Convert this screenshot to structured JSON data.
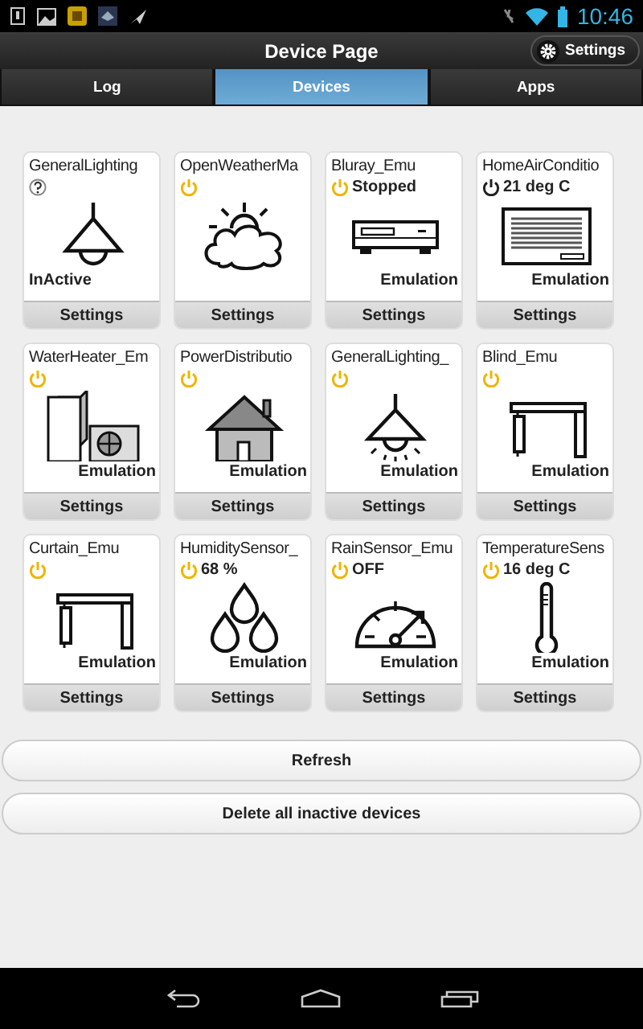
{
  "status_bar": {
    "time": "10:46"
  },
  "header": {
    "title": "Device Page",
    "settings_button": "Settings"
  },
  "tabs": [
    {
      "label": "Log",
      "selected": false
    },
    {
      "label": "Devices",
      "selected": true
    },
    {
      "label": "Apps",
      "selected": false
    }
  ],
  "devices": [
    {
      "name": "GeneralLighting",
      "unknown": true,
      "kind": "lamp",
      "mode": "InActive",
      "settings_button": "Settings"
    },
    {
      "name": "OpenWeatherMa",
      "unknown": false,
      "on": true,
      "kind": "weather",
      "settings_button": "Settings"
    },
    {
      "name": "Bluray_Emu",
      "unknown": false,
      "on": true,
      "status": "Stopped",
      "kind": "player",
      "mode": "Emulation",
      "settings_button": "Settings"
    },
    {
      "name": "HomeAirConditio",
      "unknown": false,
      "on": false,
      "status": "21 deg C",
      "kind": "aircon",
      "mode": "Emulation",
      "settings_button": "Settings"
    },
    {
      "name": "WaterHeater_Em",
      "unknown": false,
      "on": true,
      "kind": "heater",
      "mode": "Emulation",
      "settings_button": "Settings"
    },
    {
      "name": "PowerDistributio",
      "unknown": false,
      "on": true,
      "kind": "house",
      "mode": "Emulation",
      "settings_button": "Settings"
    },
    {
      "name": "GeneralLighting_",
      "unknown": false,
      "on": true,
      "kind": "lamp_lit",
      "mode": "Emulation",
      "settings_button": "Settings"
    },
    {
      "name": "Blind_Emu",
      "unknown": false,
      "on": true,
      "kind": "blind",
      "mode": "Emulation",
      "settings_button": "Settings"
    },
    {
      "name": "Curtain_Emu",
      "unknown": false,
      "on": true,
      "kind": "blind",
      "mode": "Emulation",
      "settings_button": "Settings"
    },
    {
      "name": "HumiditySensor_",
      "unknown": false,
      "on": true,
      "status": "68 %",
      "kind": "drops",
      "mode": "Emulation",
      "settings_button": "Settings"
    },
    {
      "name": "RainSensor_Emu",
      "unknown": false,
      "on": true,
      "status": "OFF",
      "kind": "gauge",
      "mode": "Emulation",
      "settings_button": "Settings"
    },
    {
      "name": "TemperatureSens",
      "unknown": false,
      "on": true,
      "status": "16 deg C",
      "kind": "thermometer",
      "mode": "Emulation",
      "settings_button": "Settings"
    }
  ],
  "buttons": [
    {
      "label": "Refresh"
    },
    {
      "label": "Delete all inactive devices"
    }
  ]
}
